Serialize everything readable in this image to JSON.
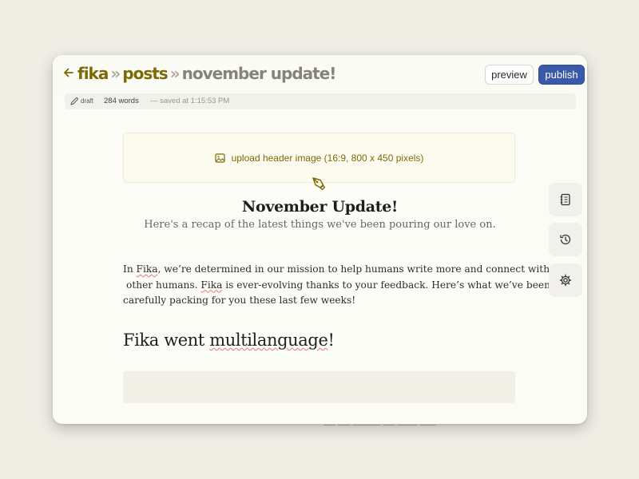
{
  "breadcrumb": {
    "root": "fika",
    "separator": "»",
    "section": "posts",
    "current": "november update!"
  },
  "toolbar": {
    "preview_label": "preview",
    "publish_label": "publish"
  },
  "status": {
    "draft_label": "draft",
    "word_count": "284 words",
    "saved_text": "— saved at 1:15:53 PM"
  },
  "upload": {
    "label": "upload header image (16:9, 800 x 450 pixels)"
  },
  "post": {
    "title": "November Update!",
    "subtitle": "Here's a recap of the latest things we've been pouring our love on.",
    "paragraph": {
      "line1_pre": "In ",
      "line1_brand": "Fika",
      "line1_post": ", we’re determined in our mission to help humans write more and connect with",
      "line2_pre": "other humans. ",
      "line2_brand": "Fika",
      "line2_post": " is ever-evolving thanks to your feedback. Here’s what we’ve been",
      "line3": "carefully packing for you these last few weeks!"
    },
    "heading_pre": "Fika went ",
    "heading_word": "multilanguage",
    "heading_post": "!"
  },
  "sidebar": {
    "icons": [
      "notebook-icon",
      "history-icon",
      "gear-icon"
    ]
  },
  "background": {
    "text": "___ ___ _______ ___ _____ ____"
  },
  "colors": {
    "accent": "#7b6a06",
    "publish": "#3a59a7",
    "page_bg": "#efede4"
  }
}
